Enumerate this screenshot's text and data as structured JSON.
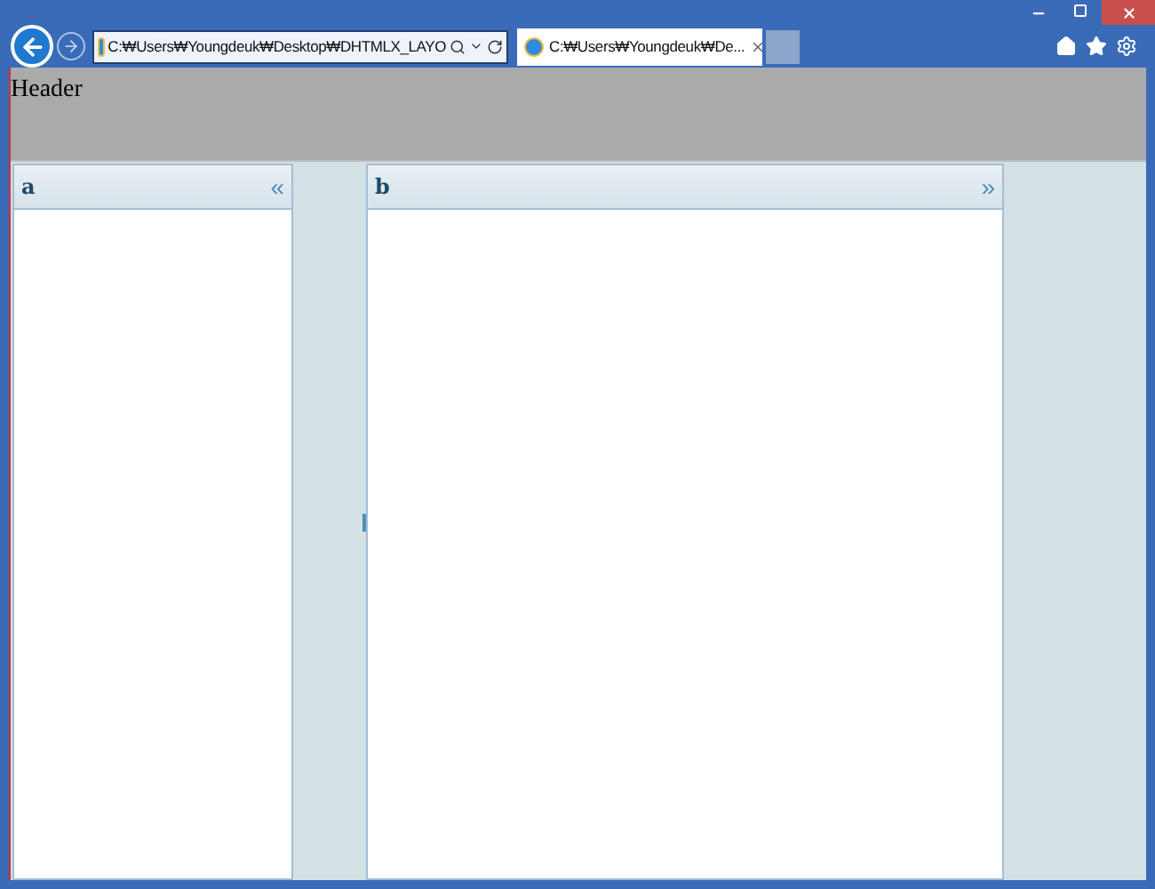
{
  "browser": {
    "address": "C:₩Users₩Youngdeuk₩Desktop₩DHTMLX_LAYO",
    "tab": {
      "title": "C:₩Users₩Youngdeuk₩De...",
      "selected": true
    }
  },
  "header": {
    "text": "Header"
  },
  "cells": [
    {
      "title": "a",
      "toggle": "«"
    },
    {
      "title": "b",
      "toggle": "»"
    }
  ]
}
